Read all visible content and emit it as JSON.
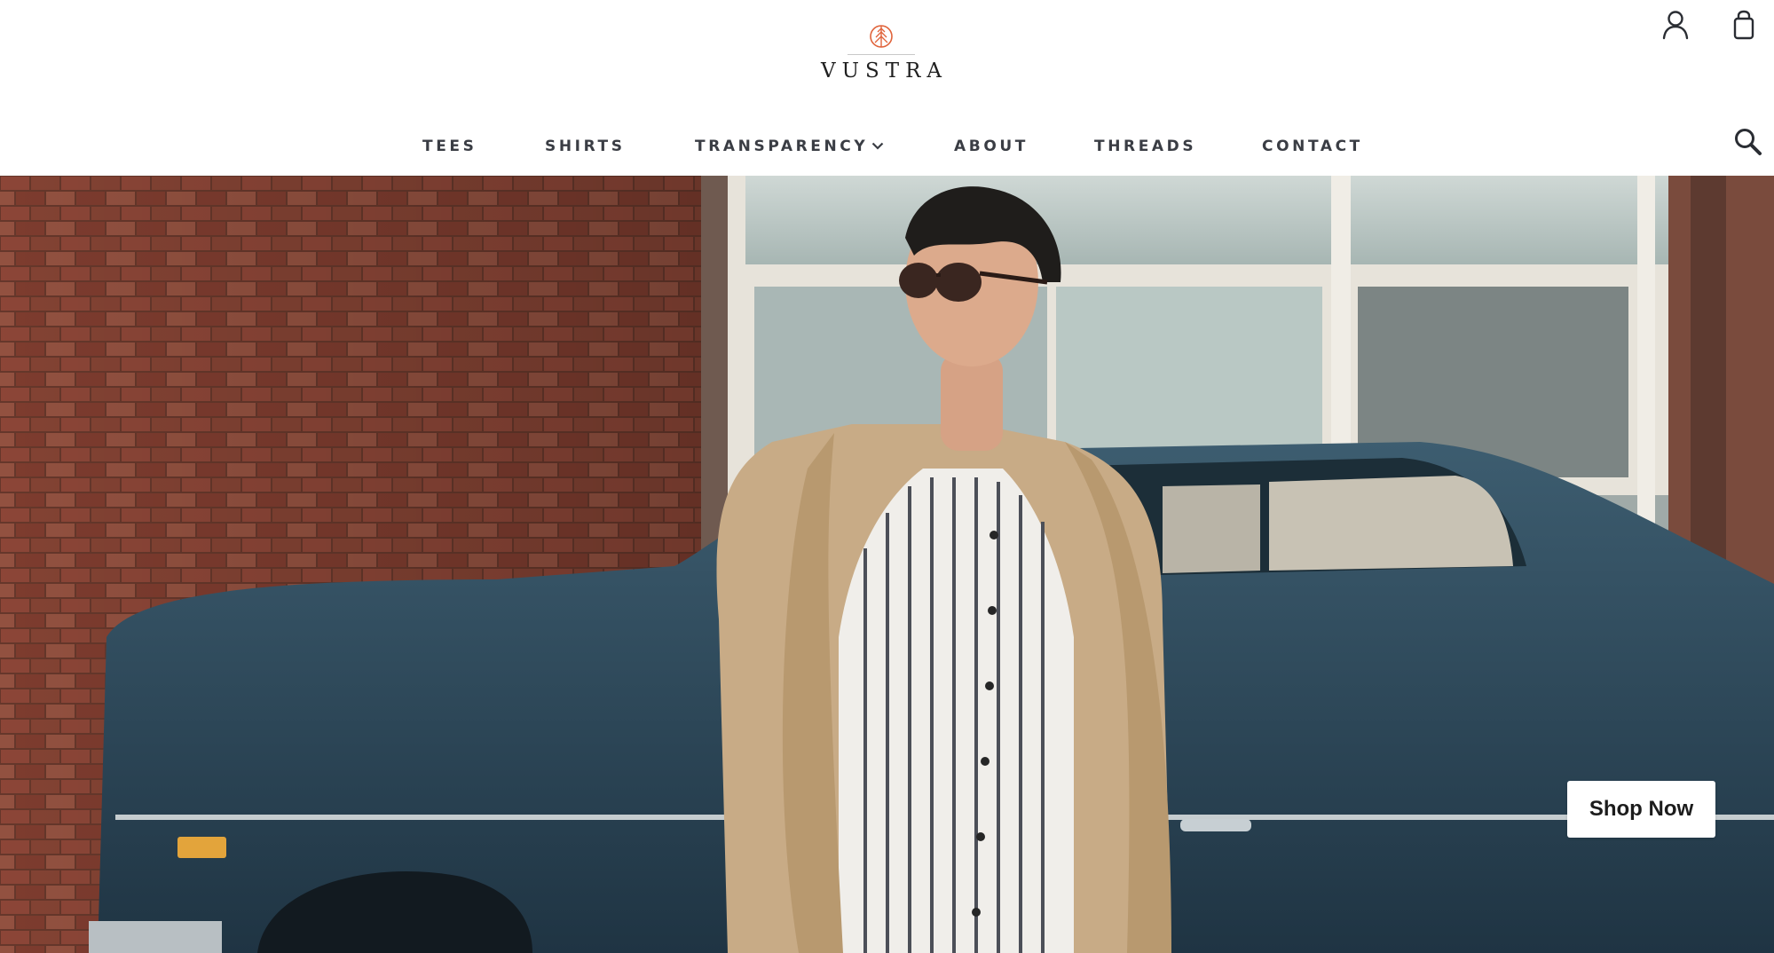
{
  "brand": {
    "name": "VUSTRA",
    "accent": "#e0633a"
  },
  "header": {
    "icons": [
      "account-icon",
      "cart-icon",
      "search-icon"
    ]
  },
  "nav": {
    "items": [
      {
        "label": "TEES"
      },
      {
        "label": "SHIRTS"
      },
      {
        "label": "TRANSPARENCY",
        "has_dropdown": true
      },
      {
        "label": "ABOUT"
      },
      {
        "label": "THREADS"
      },
      {
        "label": "CONTACT"
      }
    ]
  },
  "hero": {
    "cta_label": "Shop Now"
  },
  "colors": {
    "nav_text": "#3a3d44",
    "brick": "#8a4535",
    "car": "#2c4a5c",
    "jacket": "#c8ab86"
  }
}
